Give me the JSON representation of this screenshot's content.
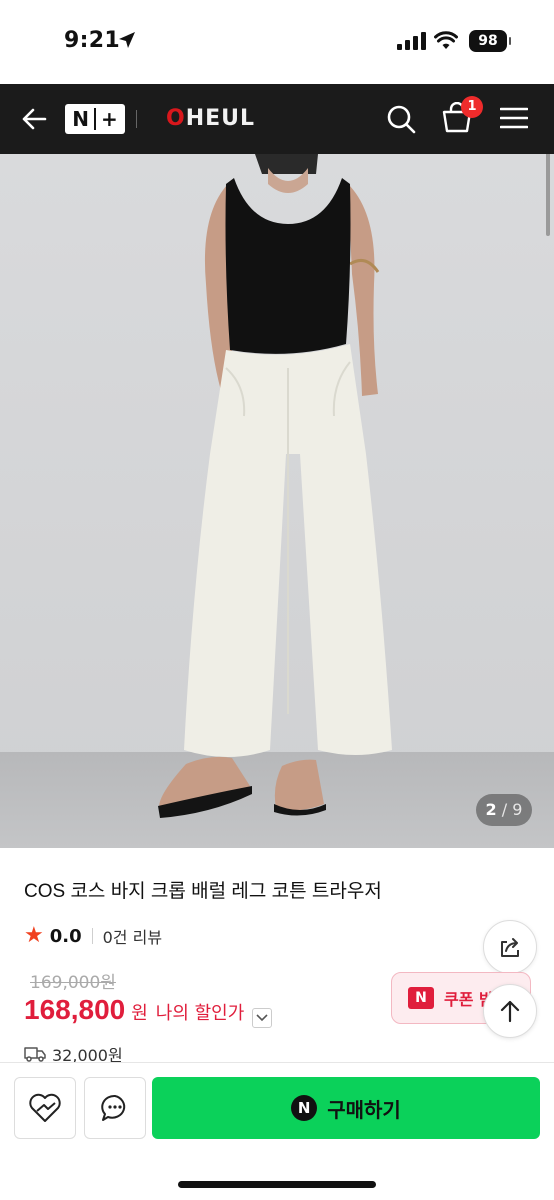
{
  "status_bar": {
    "time": "9:21",
    "battery": "98"
  },
  "header": {
    "nplus_logo": "N+",
    "brand_first": "O",
    "brand_rest": "HEUL",
    "cart_count": "1"
  },
  "gallery": {
    "current": "2",
    "separator": "/",
    "total": "9"
  },
  "product": {
    "title": "COS 코스 바지 크롭 배럴 레그 코튼 트라우저",
    "rating": "0.0",
    "review_count": "0건 리뷰",
    "original_price": "169,000원",
    "price": "168,800",
    "price_unit": "원",
    "my_discount_label": "나의 할인가",
    "shipping_fee": "32,000원"
  },
  "coupon": {
    "badge": "N",
    "label": "쿠폰 받"
  },
  "bottom_bar": {
    "buy_badge": "N",
    "buy_label": "구매하기"
  },
  "colors": {
    "brand_red": "#d8171c",
    "price_red": "#e01e3c",
    "buy_green": "#0bd15a",
    "header_bg": "#1b1b1b",
    "star": "#f0411f"
  },
  "icons": [
    "location-arrow-icon",
    "signal-icon",
    "wifi-icon",
    "back-arrow-icon",
    "search-icon",
    "cart-icon",
    "hamburger-menu-icon",
    "star-icon",
    "share-icon",
    "chevron-down-icon",
    "scroll-top-arrow-icon",
    "truck-icon",
    "heart-icon",
    "chat-icon"
  ]
}
